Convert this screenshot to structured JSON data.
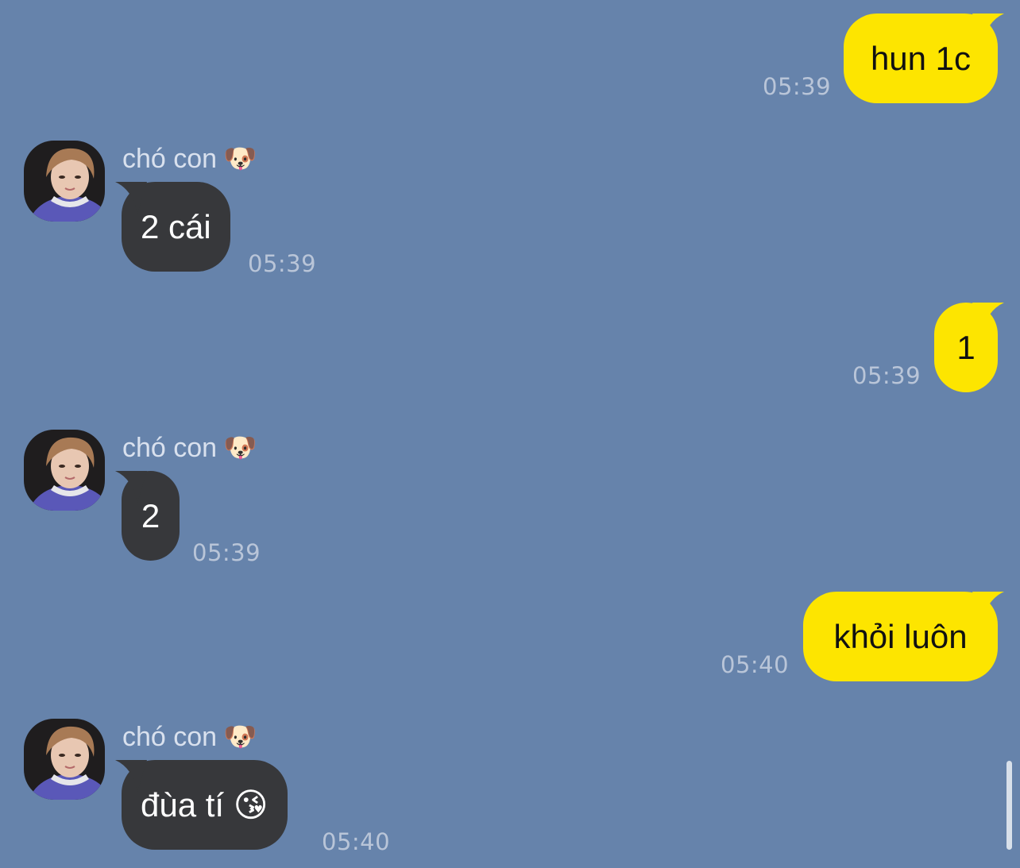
{
  "messages": [
    {
      "direction": "out",
      "text": "hun 1c",
      "time": "05:39"
    },
    {
      "direction": "in",
      "sender": "chó con",
      "sender_emoji": "🐶",
      "text": "2 cái",
      "time": "05:39"
    },
    {
      "direction": "out",
      "text": "1",
      "time": "05:39"
    },
    {
      "direction": "in",
      "sender": "chó con",
      "sender_emoji": "🐶",
      "text": "2",
      "time": "05:39"
    },
    {
      "direction": "out",
      "text": "khỏi luôn",
      "time": "05:40"
    },
    {
      "direction": "in",
      "sender": "chó con",
      "sender_emoji": "🐶",
      "text": "đùa tí 😘",
      "time": "05:40"
    }
  ],
  "colors": {
    "background": "#6683ab",
    "outgoing_bubble": "#fde500",
    "incoming_bubble": "#37383b",
    "timestamp": "#b9c5d8"
  }
}
